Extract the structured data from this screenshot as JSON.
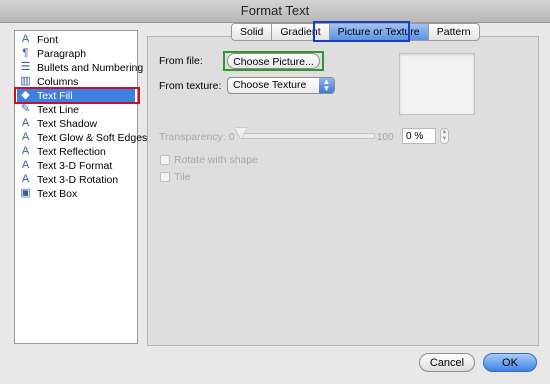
{
  "window": {
    "title": "Format Text"
  },
  "sidebar": {
    "items": [
      {
        "label": "Font",
        "icon": "font-icon",
        "glyph": "A"
      },
      {
        "label": "Paragraph",
        "icon": "paragraph-icon",
        "glyph": "¶"
      },
      {
        "label": "Bullets and Numbering",
        "icon": "bullets-icon",
        "glyph": "☰"
      },
      {
        "label": "Columns",
        "icon": "columns-icon",
        "glyph": "▥"
      },
      {
        "label": "Text Fill",
        "icon": "text-fill-icon",
        "glyph": "◆",
        "selected": true
      },
      {
        "label": "Text Line",
        "icon": "text-line-icon",
        "glyph": "✎"
      },
      {
        "label": "Text Shadow",
        "icon": "text-shadow-icon",
        "glyph": "A"
      },
      {
        "label": "Text Glow & Soft Edges",
        "icon": "text-glow-icon",
        "glyph": "A"
      },
      {
        "label": "Text Reflection",
        "icon": "text-reflection-icon",
        "glyph": "A"
      },
      {
        "label": "Text 3-D Format",
        "icon": "text-3d-format-icon",
        "glyph": "A"
      },
      {
        "label": "Text 3-D Rotation",
        "icon": "text-3d-rotation-icon",
        "glyph": "A"
      },
      {
        "label": "Text Box",
        "icon": "text-box-icon",
        "glyph": "▣"
      }
    ]
  },
  "tabs": [
    {
      "label": "Solid"
    },
    {
      "label": "Gradient"
    },
    {
      "label": "Picture or Texture",
      "active": true
    },
    {
      "label": "Pattern"
    }
  ],
  "form": {
    "from_file_label": "From file:",
    "choose_picture": "Choose Picture...",
    "from_texture_label": "From texture:",
    "texture_select": "Choose Texture",
    "transparency_label": "Transparency:",
    "slider_min": "0",
    "slider_max": "100",
    "transparency_value": "0 %",
    "transparency_level": 0,
    "rotate_label": "Rotate with shape",
    "tile_label": "Tile"
  },
  "footer": {
    "cancel": "Cancel",
    "ok": "OK"
  },
  "colors": {
    "selection": "#3d80df",
    "highlight_red": "#c8102e",
    "highlight_blue": "#1b3ec7",
    "highlight_green": "#2e9a2e"
  }
}
